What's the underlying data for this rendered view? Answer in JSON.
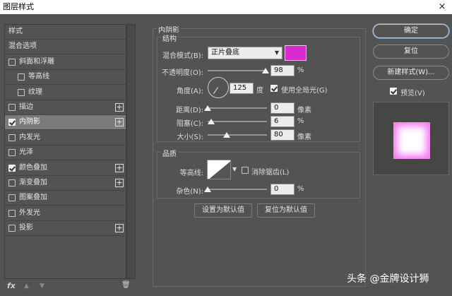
{
  "window": {
    "title": "图层样式",
    "close_glyph": "×"
  },
  "styles_list": {
    "items": [
      {
        "label": "样式",
        "checkbox": false,
        "checked": false,
        "plus": false,
        "selected": false,
        "indent": 0
      },
      {
        "label": "混合选项",
        "checkbox": false,
        "checked": false,
        "plus": false,
        "selected": false,
        "indent": 0
      },
      {
        "label": "斜面和浮雕",
        "checkbox": true,
        "checked": false,
        "plus": false,
        "selected": false,
        "indent": 0
      },
      {
        "label": "等高线",
        "checkbox": true,
        "checked": false,
        "plus": false,
        "selected": false,
        "indent": 1
      },
      {
        "label": "纹理",
        "checkbox": true,
        "checked": false,
        "plus": false,
        "selected": false,
        "indent": 1
      },
      {
        "label": "描边",
        "checkbox": true,
        "checked": false,
        "plus": true,
        "selected": false,
        "indent": 0
      },
      {
        "label": "内阴影",
        "checkbox": true,
        "checked": true,
        "plus": true,
        "selected": true,
        "indent": 0
      },
      {
        "label": "内发光",
        "checkbox": true,
        "checked": false,
        "plus": false,
        "selected": false,
        "indent": 0
      },
      {
        "label": "光泽",
        "checkbox": true,
        "checked": false,
        "plus": false,
        "selected": false,
        "indent": 0
      },
      {
        "label": "颜色叠加",
        "checkbox": true,
        "checked": true,
        "plus": true,
        "selected": false,
        "indent": 0
      },
      {
        "label": "渐变叠加",
        "checkbox": true,
        "checked": false,
        "plus": true,
        "selected": false,
        "indent": 0
      },
      {
        "label": "图案叠加",
        "checkbox": true,
        "checked": false,
        "plus": false,
        "selected": false,
        "indent": 0
      },
      {
        "label": "外发光",
        "checkbox": true,
        "checked": false,
        "plus": false,
        "selected": false,
        "indent": 0
      },
      {
        "label": "投影",
        "checkbox": true,
        "checked": false,
        "plus": true,
        "selected": false,
        "indent": 0
      }
    ],
    "plus_glyph": "+",
    "bottom_icons": {
      "fx": "fx",
      "up": "▲",
      "down": "▼",
      "trash": "🗑"
    }
  },
  "inner_shadow": {
    "section_title": "内阴影",
    "structure": {
      "title": "结构",
      "blend_mode_label": "混合模式(B):",
      "blend_mode_value": "正片叠底",
      "blend_color": "#d92ad0",
      "opacity_label": "不透明度(O):",
      "opacity_value": "98",
      "opacity_fraction": 0.98,
      "angle_label": "角度(A):",
      "angle_value": "125",
      "angle_unit": "度",
      "global_light_label": "使用全局光(G)",
      "global_light_checked": true,
      "distance_label": "距离(D):",
      "distance_value": "0",
      "distance_unit": "像素",
      "distance_fraction": 0.0,
      "choke_label": "阻塞(C):",
      "choke_value": "6",
      "choke_fraction": 0.06,
      "size_label": "大小(S):",
      "size_value": "80",
      "size_unit": "像素",
      "size_fraction": 0.32
    },
    "quality": {
      "title": "品质",
      "contour_label": "等高线:",
      "antialias_label": "消除锯齿(L)",
      "antialias_checked": false,
      "noise_label": "杂色(N):",
      "noise_value": "0",
      "noise_fraction": 0.0
    },
    "percent": "%",
    "make_default": "设置为默认值",
    "reset_default": "复位为默认值"
  },
  "right_panel": {
    "ok": "确定",
    "reset": "复位",
    "new_style": "新建样式(W)...",
    "preview_label": "预览(V)",
    "preview_checked": true
  },
  "watermark": "头条 @金牌设计狮"
}
